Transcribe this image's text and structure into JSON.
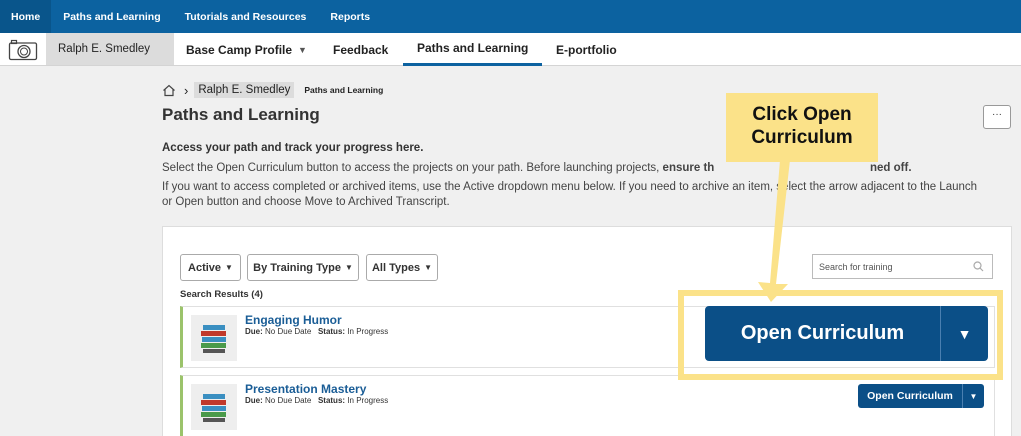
{
  "topnav": {
    "items": [
      "Home",
      "Paths and Learning",
      "Tutorials and Resources",
      "Reports"
    ]
  },
  "profilebar": {
    "user_name": "Ralph E. Smedley",
    "tabs": [
      "Base Camp Profile",
      "Feedback",
      "Paths and Learning",
      "E-portfolio"
    ],
    "active_tab": "Paths and Learning"
  },
  "breadcrumb": {
    "user": "Ralph E. Smedley",
    "current": "Paths and Learning"
  },
  "page": {
    "title": "Paths and Learning",
    "more_label": "···",
    "intro_heading": "Access your path and track your progress here.",
    "intro_line1a": "Select the Open Curriculum button to access the projects on your path. Before launching projects,",
    "intro_line1b": "ensure th",
    "intro_line1c": "ned off.",
    "intro_line2": "If you want to access completed or archived items, use the Active dropdown menu below. If you need to archive an item, select the arrow adjacent to the Launch",
    "intro_line3": "or Open button and choose Move to Archived Transcript."
  },
  "filters": {
    "status": "Active",
    "type_group": "By Training Type",
    "types": "All Types"
  },
  "search": {
    "placeholder": "Search for training"
  },
  "results": {
    "label": "Search Results (4)",
    "items": [
      {
        "title": "Engaging Humor",
        "due_label": "Due:",
        "due": "No Due Date",
        "status_label": "Status:",
        "status": "In Progress"
      },
      {
        "title": "Presentation Mastery",
        "due_label": "Due:",
        "due": "No Due Date",
        "status_label": "Status:",
        "status": "In Progress"
      }
    ]
  },
  "action_button": {
    "label": "Open Curriculum"
  },
  "annotation": {
    "callout_line1": "Click Open",
    "callout_line2": "Curriculum",
    "color": "#fbe289"
  },
  "colors": {
    "nav": "#0c62a0",
    "button": "#0b4f87",
    "link": "#1a5d96"
  }
}
